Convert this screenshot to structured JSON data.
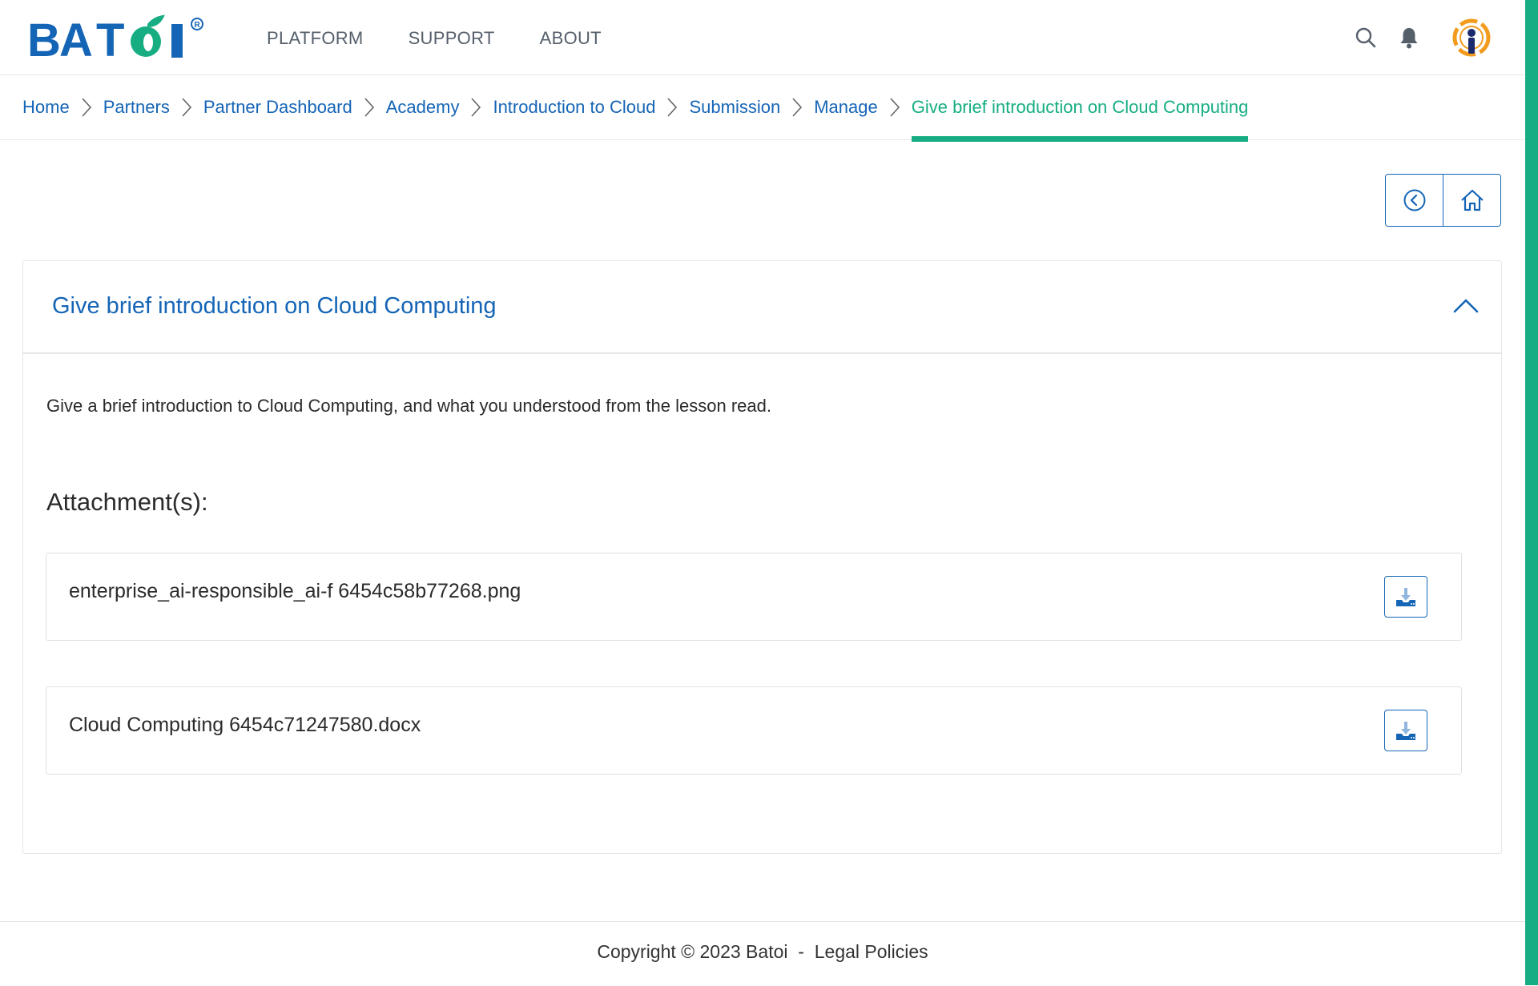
{
  "brand": {
    "logo_text": "BATOI",
    "registered_mark": "®",
    "accent_color": "#17ad83",
    "link_color": "#1565b6"
  },
  "nav": {
    "items": [
      "PLATFORM",
      "SUPPORT",
      "ABOUT"
    ]
  },
  "header_icons": [
    "search-icon",
    "bell-icon",
    "user-avatar"
  ],
  "breadcrumb": {
    "items": [
      "Home",
      "Partners",
      "Partner Dashboard",
      "Academy",
      "Introduction to Cloud",
      "Submission",
      "Manage"
    ],
    "current": "Give brief introduction on Cloud Computing"
  },
  "toolbar": {
    "buttons": [
      "back-circle-icon",
      "home-icon"
    ]
  },
  "card": {
    "title": "Give brief introduction on Cloud Computing",
    "description": "Give a brief introduction to Cloud Computing, and what you understood from the lesson read.",
    "attachments_heading": "Attachment(s):",
    "attachments": [
      {
        "name": "enterprise_ai-responsible_ai-f 6454c58b77268.png"
      },
      {
        "name": "Cloud Computing 6454c71247580.docx"
      }
    ]
  },
  "footer": {
    "copyright": "Copyright © 2023 Batoi",
    "separator": "-",
    "legal_link": "Legal Policies"
  }
}
